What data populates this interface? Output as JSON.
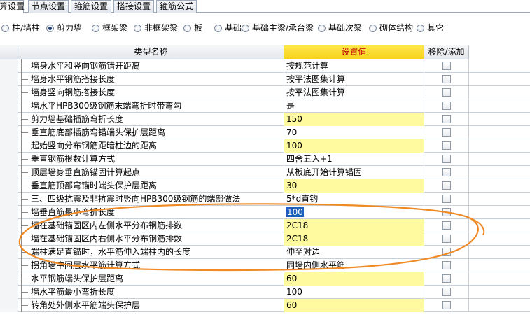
{
  "tabs": [
    "算设置",
    "节点设置",
    "箍筋设置",
    "搭接设置",
    "箍筋公式"
  ],
  "active_tab": 0,
  "radios": [
    "柱/墙柱",
    "剪力墙",
    "框架梁",
    "非框架梁",
    "板",
    "基础",
    "基础主梁/承台梁",
    "基础次梁",
    "砌体结构",
    "其它"
  ],
  "selected_radio": 1,
  "table": {
    "col_name": "类型名称",
    "col_value": "设置值",
    "col_toggle": "移除/添加",
    "rows": [
      {
        "name": "墙身水平和竖向钢筋错开距离",
        "value": "按规范计算",
        "hl": false
      },
      {
        "name": "墙身水平钢筋搭接长度",
        "value": "按平法图集计算",
        "hl": false
      },
      {
        "name": "墙身竖向钢筋搭接长度",
        "value": "按平法图集计算",
        "hl": false
      },
      {
        "name": "墙水平HPB300级钢筋末端弯折时带弯勾",
        "value": "是",
        "hl": false
      },
      {
        "name": "剪力墙基础插筋弯折长度",
        "value": "150",
        "hl": true
      },
      {
        "name": "垂直筋底部插筋弯锚端头保护层距离",
        "value": "70",
        "hl": false
      },
      {
        "name": "起始竖向分布钢筋距暗柱边的距离",
        "value": "100",
        "hl": true
      },
      {
        "name": "垂直钢筋根数计算方式",
        "value": "四舍五入+1",
        "hl": false
      },
      {
        "name": "顶层墙身垂直筋锚固计算起点",
        "value": "从板底开始计算锚固",
        "hl": false
      },
      {
        "name": "垂直筋顶部弯锚时端头保护层距离",
        "value": "30",
        "hl": true
      },
      {
        "name": "三、四级抗震及非抗震时竖向HPB300级钢筋的端部做法",
        "value": "5*d直钩",
        "hl": false
      },
      {
        "name": "墙垂直筋最小弯折长度",
        "value": "100",
        "hl": false,
        "sel": true
      },
      {
        "name": "墙在基础锚固区内左侧水平分布钢筋排数",
        "value": "2C18",
        "hl": true
      },
      {
        "name": "墙在基础锚固区内右侧水平分布钢筋排数",
        "value": "2C18",
        "hl": true
      },
      {
        "name": "端柱满足直锚时，水平筋伸入端柱内的长度",
        "value": "伸至对边",
        "hl": false
      },
      {
        "name": "拐角墙中间层水平筋计算方式",
        "value": "同墙内侧水平筋",
        "hl": false
      },
      {
        "name": "水平钢筋端头保护层距离",
        "value": "60",
        "hl": true
      },
      {
        "name": "墙水平筋最小弯折长度",
        "value": "100",
        "hl": false
      },
      {
        "name": "转角处外侧水平筋端头保护层",
        "value": "60",
        "hl": true
      }
    ]
  },
  "colors": {
    "value_header": "#f6d21a",
    "highlight": "#fffaa0",
    "annotation": "#f08a24"
  }
}
